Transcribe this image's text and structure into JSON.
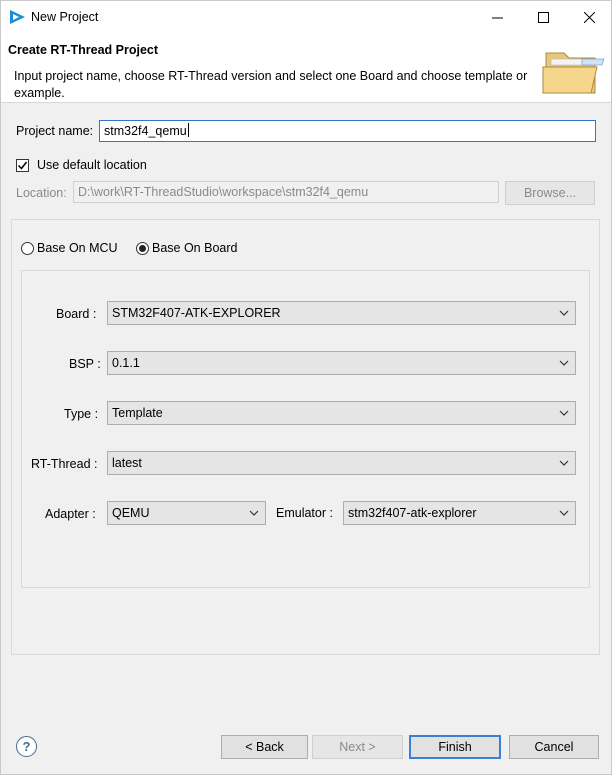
{
  "window": {
    "title": "New Project"
  },
  "header": {
    "title": "Create RT-Thread Project",
    "description": "Input project name, choose RT-Thread version and select one Board and choose template or example."
  },
  "form": {
    "project_name_label": "Project name:",
    "project_name_value": "stm32f4_qemu",
    "use_default_location_label": "Use default location",
    "use_default_location_checked": true,
    "location_label": "Location:",
    "location_value": "D:\\work\\RT-ThreadStudio\\workspace\\stm32f4_qemu",
    "browse_label": "Browse...",
    "base_on_mcu_label": "Base On MCU",
    "base_on_board_label": "Base On Board",
    "selected_base": "board",
    "board_label": "Board :",
    "board_value": "STM32F407-ATK-EXPLORER",
    "bsp_label": "BSP :",
    "bsp_value": "0.1.1",
    "type_label": "Type :",
    "type_value": "Template",
    "rtthread_label": "RT-Thread :",
    "rtthread_value": "latest",
    "adapter_label": "Adapter :",
    "adapter_value": "QEMU",
    "emulator_label": "Emulator :",
    "emulator_value": "stm32f407-atk-explorer"
  },
  "footer": {
    "help_label": "?",
    "back_label": "< Back",
    "next_label": "Next >",
    "finish_label": "Finish",
    "cancel_label": "Cancel"
  },
  "colors": {
    "accent": "#3c7fd6",
    "app_icon": "#1b8fd6"
  }
}
